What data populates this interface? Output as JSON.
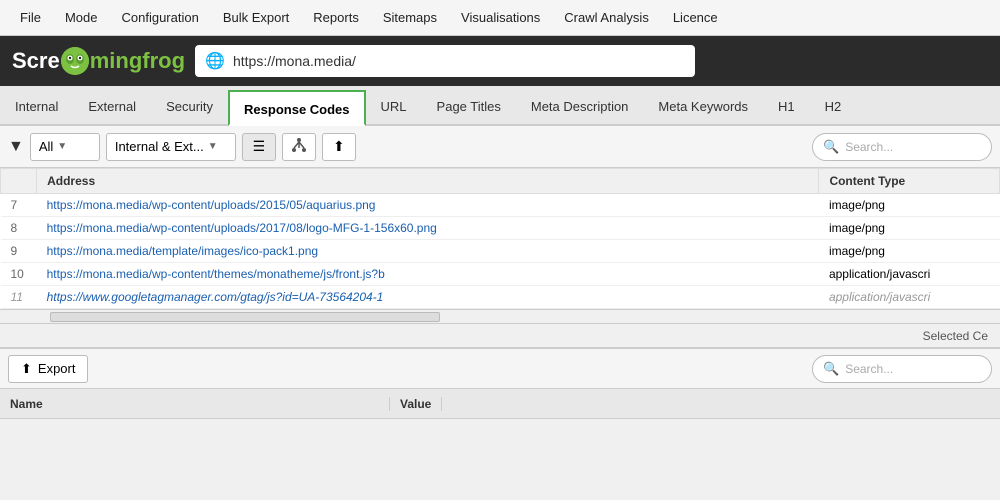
{
  "menu": {
    "items": [
      "File",
      "Mode",
      "Configuration",
      "Bulk Export",
      "Reports",
      "Sitemaps",
      "Visualisations",
      "Crawl Analysis",
      "Licence"
    ]
  },
  "address_bar": {
    "logo_part1": "Scre",
    "logo_icon": "☺",
    "logo_part2": "ming",
    "logo_part3": "frog",
    "url": "https://mona.media/"
  },
  "tabs": {
    "items": [
      "Internal",
      "External",
      "Security",
      "Response Codes",
      "URL",
      "Page Titles",
      "Meta Description",
      "Meta Keywords",
      "H1",
      "H2"
    ],
    "active": "Response Codes"
  },
  "filter": {
    "label": "All",
    "dropdown2_label": "Internal & Ext...",
    "list_icon": "☰",
    "tree_icon": "⎇",
    "upload_icon": "⬆",
    "search_placeholder": "Search..."
  },
  "table": {
    "col_address": "Address",
    "col_content_type": "Content Type",
    "rows": [
      {
        "num": "7",
        "address": "https://mona.media/wp-content/uploads/2015/05/aquarius.png",
        "content_type": "image/png"
      },
      {
        "num": "8",
        "address": "https://mona.media/wp-content/uploads/2017/08/logo-MFG-1-156x60.png",
        "content_type": "image/png"
      },
      {
        "num": "9",
        "address": "https://mona.media/template/images/ico-pack1.png",
        "content_type": "image/png"
      },
      {
        "num": "10",
        "address": "https://mona.media/wp-content/themes/monatheme/js/front.js?b",
        "content_type": "application/javascri"
      },
      {
        "num": "11",
        "address": "https://www.googletagmanager.com/gtag/js?id=UA-73564204-1",
        "content_type": "application/javascri"
      }
    ]
  },
  "selected_ce": "Selected Ce",
  "bottom": {
    "export_icon": "⬆",
    "export_label": "Export",
    "search_placeholder": "Search...",
    "col_name": "Name",
    "col_value": "Value"
  }
}
